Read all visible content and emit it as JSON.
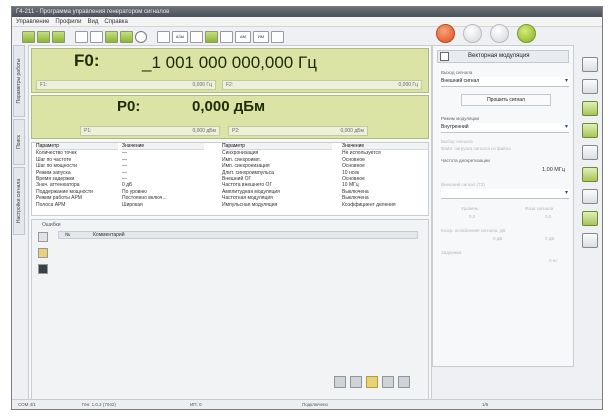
{
  "window": {
    "title": "Г4-211 - Программа управления генератором сигналов"
  },
  "menu": [
    "Управление",
    "Профили",
    "Вид",
    "Справка"
  ],
  "toolbar": {
    "auto_labels": [
      "АЗЫ",
      "АМ",
      "ИМ"
    ]
  },
  "main": {
    "freq": {
      "label": "F0:",
      "value": "_1 001 000 000,000",
      "unit": "Гц",
      "f1_label": "F1:",
      "f1_value": "0,000 Гц",
      "f2_label": "F2:",
      "f2_value": "0,000 Гц"
    },
    "power": {
      "label": "P0:",
      "value": "0,000 дБм",
      "p1_label": "P1:",
      "p1_value": "0,000 дБм",
      "p2_label": "P2:",
      "p2_value": "0,000 дБм"
    },
    "params": {
      "col_param": "Параметр",
      "col_value": "Значение",
      "left": [
        [
          "Количество точек",
          "—"
        ],
        [
          "Шаг по частоте",
          "—"
        ],
        [
          "Шаг по мощности",
          "—"
        ],
        [
          "Режим запуска",
          "—"
        ],
        [
          "Время задержки",
          "—"
        ],
        [
          "Знач. аттенюатора",
          "0 дБ"
        ],
        [
          "Поддержание мощности",
          "По уровню"
        ],
        [
          "Режим работы АРМ",
          "Постоянно включ..."
        ],
        [
          "Полоса АРМ",
          "Широкая"
        ]
      ],
      "right": [
        [
          "Синхронизация",
          "Не используется"
        ],
        [
          "Имп. синхроимп.",
          "Основное"
        ],
        [
          "Имп. синхронизация",
          "Основное"
        ],
        [
          "Длит. синхроимпульса",
          "10 нсек"
        ],
        [
          "Внешний ОГ",
          "Основное"
        ],
        [
          "Частота внешнего ОГ",
          "10 МГц"
        ],
        [
          "Амплитудная модуляция",
          "Выключена"
        ],
        [
          "Частотная модуляция",
          "Выключена"
        ],
        [
          "Импульсная модуляция",
          "Выключена"
        ]
      ],
      "right_last_extra": "Коэффициент деления"
    },
    "errors": {
      "caption": "Ошибки",
      "col_num": "№",
      "col_comment": "Комментарий"
    }
  },
  "right_panel": {
    "title": "Векторная модуляция",
    "labels": {
      "source_mode": "Выход сигнала",
      "source_value": "Внешний сигнал",
      "gen_button": "Прошить сигнал",
      "type_label": "Режим модуляции",
      "type_value": "Внутренний",
      "sig_label": "Выбор сигнала",
      "sig_value": "Файл: загрузка сигнала из файла",
      "rate_label": "Частота дискретизации",
      "rate_value": "1,00 МГц",
      "ext_label": "Внешний сигнал (T2)",
      "dis1_a": "Уровень",
      "dis1_b": "Фаза сигнала",
      "dis1_a_val": "0,0",
      "dis1_b_val": "0,0",
      "dis2_label": "Коэф. ослабления сигнала, дБ",
      "dis2_a": "0 дБ",
      "dis2_b": "0 дБ",
      "dis3_label": "Задержка",
      "dis3_val": "0 нс"
    }
  },
  "side_tabs": [
    "Параметры работы",
    "Поиск",
    "Настройки сигнала"
  ],
  "status": {
    "item1": "СОМ 4/1",
    "item2": "Ген: 1.0.2 (7042)",
    "item3": "ИП: 0",
    "item4": "Подключено",
    "item5": "1/5"
  },
  "colors": {
    "display_green": "#dbe3a5",
    "accent_red": "#de4f1e",
    "accent_green": "#86ad28"
  }
}
